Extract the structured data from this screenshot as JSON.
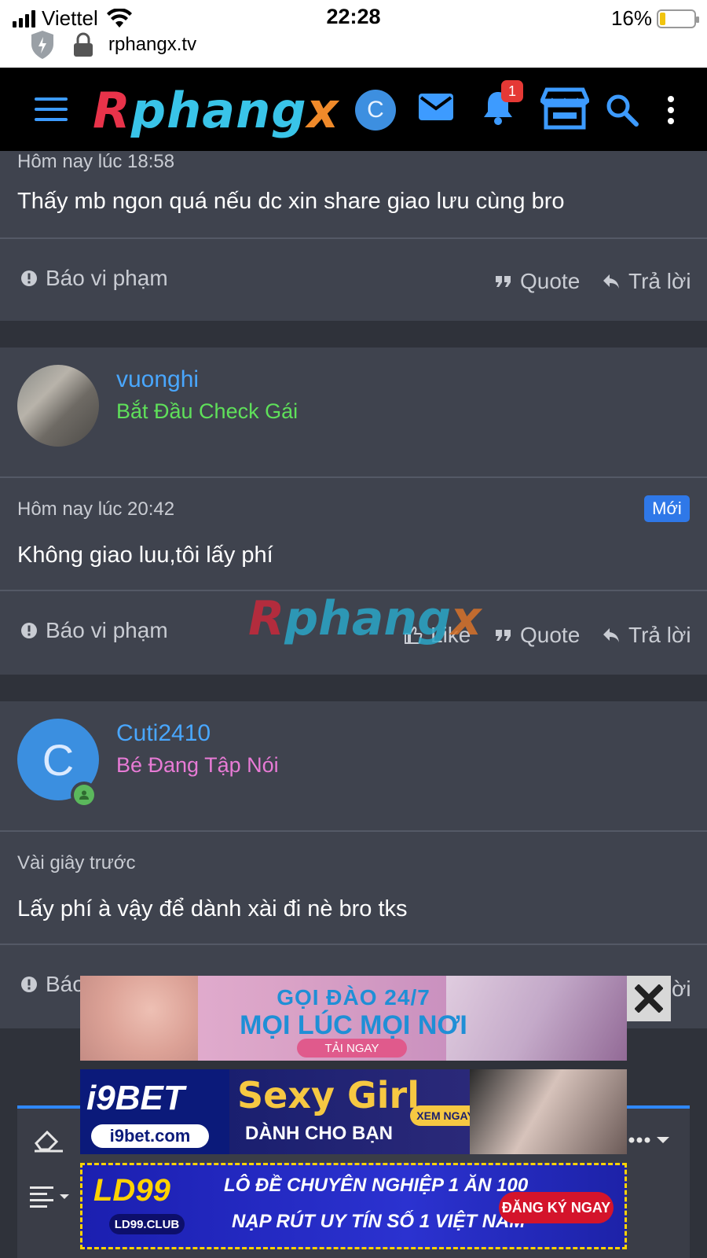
{
  "status_bar": {
    "carrier": "Viettel",
    "time": "22:28",
    "battery": "16%",
    "url": "rphangx.tv"
  },
  "nav": {
    "logo_part1": "R",
    "logo_part2": "phang",
    "logo_part3": "x",
    "avatar_letter": "C",
    "notification_count": "1"
  },
  "colors": {
    "accent": "#49a7ff",
    "brand_red": "#e8334a",
    "brand_cyan": "#39c4e8",
    "online": "#5bb85c"
  },
  "posts": [
    {
      "time": "Hôm nay lúc 18:58",
      "message": "Thấy mb ngon quá nếu dc xin share giao lưu cùng bro",
      "actions": {
        "report": "Báo vi phạm",
        "quote": "Quote",
        "reply": "Trả lời"
      }
    },
    {
      "username": "vuonghi",
      "user_title": "Bắt Đầu Check Gái",
      "user_title_color": "#5fe05a",
      "time": "Hôm nay lúc 20:42",
      "badge": "Mới",
      "message": "Không giao luu,tôi lấy phí",
      "actions": {
        "report": "Báo vi phạm",
        "like": "Like",
        "quote": "Quote",
        "reply": "Trả lời"
      }
    },
    {
      "username": "Cuti2410",
      "avatar_letter": "C",
      "user_title": "Bé Đang Tập Nói",
      "user_title_color": "#e87bd6",
      "time": "Vài giây trước",
      "message": "Lấy phí à vậy để dành xài đi nè bro tks",
      "actions": {
        "report": "Báo",
        "reply": "Trả lời"
      }
    }
  ],
  "watermark": {
    "part1": "R",
    "part2": "phang",
    "part3": "x"
  },
  "ads": [
    {
      "line1": "GỌI ĐÀO 24/7",
      "line2": "MỌI LÚC MỌI NƠI",
      "cta": "TẢI NGAY"
    },
    {
      "brand": "i9BET",
      "site": "i9bet.com",
      "headline": "Sexy Girl",
      "sub": "DÀNH CHO BẠN",
      "cta": "XEM NGAY"
    },
    {
      "brand": "LD99",
      "site": "LD99.CLUB",
      "line1": "LÔ ĐỀ CHUYÊN NGHIỆP 1 ĂN 100",
      "line2": "NẠP RÚT UY TÍN SỐ 1 VIỆT NAM",
      "cta": "ĐĂNG KÝ NGAY"
    }
  ]
}
